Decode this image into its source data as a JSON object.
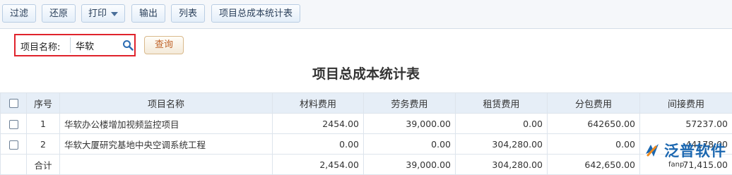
{
  "toolbar": {
    "filter": "过滤",
    "restore": "还原",
    "print": "打印",
    "export": "输出",
    "columns": "列表",
    "report": "项目总成本统计表"
  },
  "search": {
    "label": "项目名称:",
    "value": "华软",
    "query_button": "查询"
  },
  "report_title": "项目总成本统计表",
  "table": {
    "headers": [
      "序号",
      "项目名称",
      "材料费用",
      "劳务费用",
      "租赁费用",
      "分包费用",
      "间接费用"
    ],
    "rows": [
      {
        "index": "1",
        "name": "华软办公楼增加视频监控项目",
        "material": "2454.00",
        "labor": "39,000.00",
        "lease": "0.00",
        "subcontract": "642650.00",
        "indirect": "57237.00"
      },
      {
        "index": "2",
        "name": "华软大厦研究基地中央空调系统工程",
        "material": "0.00",
        "labor": "0.00",
        "lease": "304,280.00",
        "subcontract": "0.00",
        "indirect": "44178.00"
      }
    ],
    "total": {
      "label": "合计",
      "material": "2,454.00",
      "labor": "39,000.00",
      "lease": "304,280.00",
      "subcontract": "642,650.00",
      "indirect": "71,415.00"
    }
  },
  "watermark": {
    "brand": "泛普软件",
    "url": "www.fanpusoft.com",
    "visible_url": "fanp"
  },
  "colors": {
    "link": "#1e62b0",
    "header_bg": "#e6eef7",
    "highlight": "#e0232c",
    "query_text": "#c0652a"
  }
}
